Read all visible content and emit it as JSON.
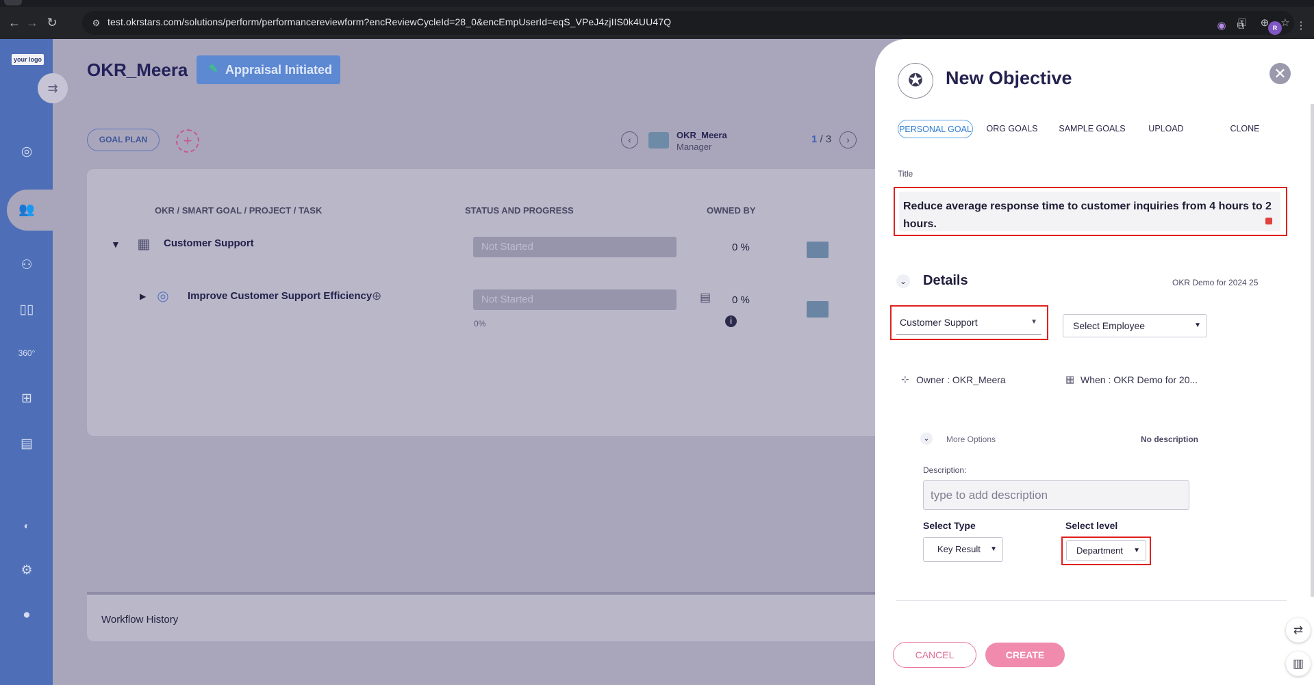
{
  "browser": {
    "url": "test.okrstars.com/solutions/perform/performancereviewform?encReviewCycleId=28_0&encEmpUserId=eqS_VPeJ4zjIIS0k4UU47Q",
    "back_icon": "arrow-left-icon",
    "forward_icon": "arrow-right-icon",
    "reload_icon": "reload-icon",
    "profile_initials": "R"
  },
  "sidebar": {
    "logo_text": "your logo",
    "items": [
      {
        "icon": "target-icon"
      },
      {
        "icon": "team-icon"
      },
      {
        "icon": "people-icon"
      },
      {
        "icon": "book-icon"
      },
      {
        "icon": "degree-360-icon"
      },
      {
        "icon": "org-chart-icon"
      },
      {
        "icon": "form-icon"
      },
      {
        "icon": "view-icon"
      },
      {
        "icon": "settings-icon"
      },
      {
        "icon": "user-icon"
      }
    ]
  },
  "header": {
    "title": "OKR_Meera",
    "status_button": "Appraisal Initiated",
    "goal_plan_button": "GOAL PLAN"
  },
  "pager": {
    "employee_name": "OKR_Meera",
    "employee_role": "Manager",
    "current": "1",
    "total": "/ 3"
  },
  "table": {
    "columns": [
      "OKR / SMART GOAL / PROJECT / TASK",
      "STATUS AND PROGRESS",
      "OWNED BY"
    ],
    "rows": [
      {
        "title": "Customer Support",
        "status": "Not Started",
        "percent": "0 %"
      },
      {
        "title": "Improve Customer Support Efficiency",
        "status": "Not Started",
        "percent": "0 %",
        "progress_label": "0%"
      }
    ]
  },
  "workflow": {
    "label": "Workflow History"
  },
  "drawer": {
    "title": "New Objective",
    "tabs": [
      "PERSONAL GOAL",
      "ORG GOALS",
      "SAMPLE GOALS",
      "UPLOAD",
      "CLONE"
    ],
    "title_label": "Title",
    "title_value": "Reduce average response time to customer inquiries from 4 hours to 2 hours.",
    "details_heading": "Details",
    "cycle_label": "OKR Demo for 2024 25",
    "department_value": "Customer Support",
    "employee_select": "Select Employee",
    "owner_text": "Owner : OKR_Meera",
    "when_text": "When : OKR Demo for 20...",
    "more_options": "More Options",
    "no_description": "No description",
    "description_label": "Description:",
    "description_placeholder": "type to add description",
    "select_type_label": "Select Type",
    "select_type_value": "Key Result",
    "select_level_label": "Select level",
    "select_level_value": "Department",
    "cancel_button": "CANCEL",
    "create_button": "CREATE"
  },
  "colors": {
    "sidebar": "#4e6fb8",
    "highlight": "#e0201f",
    "create": "#f18bad",
    "tab_active": "#2d7bd2"
  }
}
